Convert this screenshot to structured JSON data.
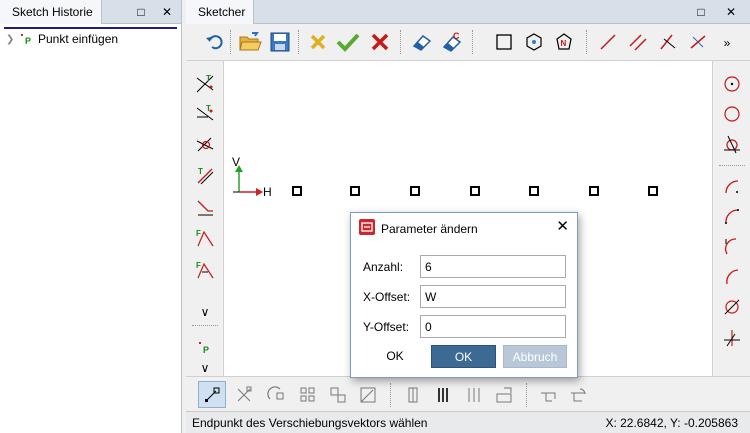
{
  "left_panel": {
    "title": "Sketch Historie",
    "items": [
      {
        "label": "Punkt einfügen"
      }
    ]
  },
  "right_panel": {
    "title": "Sketcher"
  },
  "header_buttons": {
    "restore": "□",
    "close": "✕",
    "more": "»"
  },
  "canvas": {
    "axis_v": "V",
    "axis_h": "H"
  },
  "dialog": {
    "title": "Parameter ändern",
    "close": "✕",
    "fields": [
      {
        "label": "Anzahl:",
        "value": "6"
      },
      {
        "label": "X-Offset:",
        "value": "W"
      },
      {
        "label": "Y-Offset:",
        "value": "0"
      }
    ],
    "ok_text": "OK",
    "ok_button": "OK",
    "cancel_button": "Abbruch"
  },
  "status": {
    "message": "Endpunkt des Verschiebungsvektors wählen",
    "coords": "X: 22.6842, Y: -0.205863"
  },
  "colors": {
    "accent": "#3c6a95",
    "panel_header": "#d7dfe8",
    "dialog_icon": "#c8282e",
    "axis_v": "#2aa02a",
    "axis_h": "#d02020"
  }
}
